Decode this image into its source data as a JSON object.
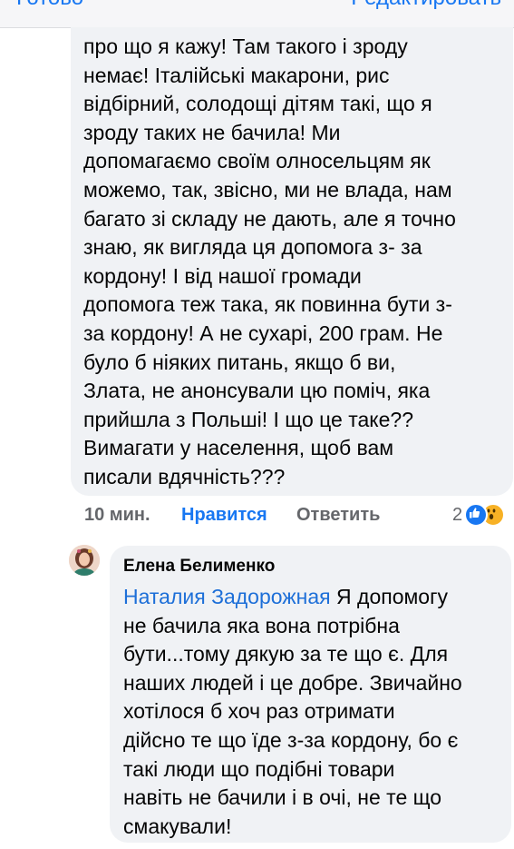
{
  "topbar": {
    "done_label": "Готово",
    "edit_label": "Редактировать"
  },
  "comment1": {
    "text": "про що я кажу! Там такого і зроду\nнемає! Італійські макарони, рис\nвідбірний, солодощі дітям такі, що я\nзроду таких не бачила! Ми\nдопомагаємо своїм олносельцям як\nможемо, так, звісно, ми не влада, нам\nбагато зі складу не дають, але я точно\nзнаю, як вигляда ця допомога з- за\nкордону! І від нашої громади\nдопомога теж така, як повинна бути з-\nза кордону! А не сухарі, 200 грам. Не\nбуло б ніяких питань, якщо б ви,\nЗлата, не анонсували цю поміч, яка\nприйшла з Польші! І що це таке??\nВимагати у населення, щоб вам\nписали вдячність???",
    "time": "10 мин.",
    "like_label": "Нравится",
    "reply_label": "Ответить",
    "reaction_count": "2",
    "reaction_icons": [
      "like-icon",
      "wow-icon"
    ]
  },
  "comment2": {
    "author": "Елена Белименко",
    "avatar_icon": "user-avatar",
    "mention": "Наталия Задорожная",
    "text": " Я допомогу\nне бачила яка вона потрібна\nбути...тому дякую за те що є. Для\nнаших людей і це добре. Звичайно\nхотілося б хоч раз отримати\nдійсно те що їде з-за кордону, бо є\nтакі люди що подібні товари\nнавіть не бачили і в очі, не те що\nсмакували!"
  },
  "colors": {
    "accent": "#1877f2",
    "bubble": "#f0f2f5",
    "muted": "#65676b",
    "wow": "#f7b125"
  }
}
